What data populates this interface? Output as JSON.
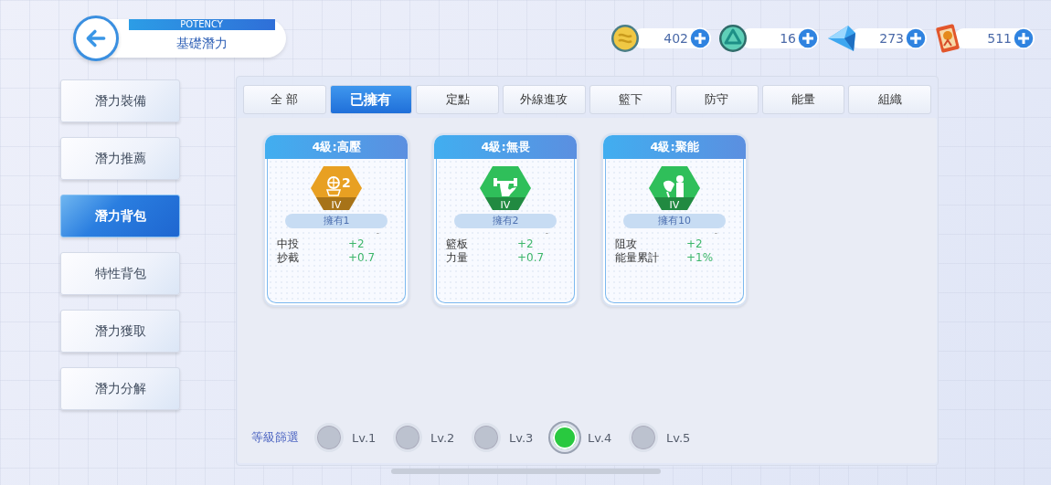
{
  "header": {
    "subtitle": "POTENCY",
    "title": "基礎潛力"
  },
  "currencies": [
    {
      "kind": "coin",
      "amount": "402"
    },
    {
      "kind": "swirl",
      "amount": "16"
    },
    {
      "kind": "gem",
      "amount": "273"
    },
    {
      "kind": "card",
      "amount": "511"
    }
  ],
  "sidebar": {
    "items": [
      {
        "label": "潛力裝備",
        "selected": false
      },
      {
        "label": "潛力推薦",
        "selected": false
      },
      {
        "label": "潛力背包",
        "selected": true
      },
      {
        "label": "特性背包",
        "selected": false
      },
      {
        "label": "潛力獲取",
        "selected": false
      },
      {
        "label": "潛力分解",
        "selected": false
      }
    ]
  },
  "tabs": [
    {
      "label": "全 部",
      "selected": false
    },
    {
      "label": "已擁有",
      "selected": true
    },
    {
      "label": "定點",
      "selected": false
    },
    {
      "label": "外線進攻",
      "selected": false
    },
    {
      "label": "籃下",
      "selected": false
    },
    {
      "label": "防守",
      "selected": false
    },
    {
      "label": "能量",
      "selected": false
    },
    {
      "label": "組織",
      "selected": false
    }
  ],
  "cards": [
    {
      "title": "4級:高壓",
      "kind": "shot",
      "color": "#e8a022",
      "badge_number": "2",
      "grade": "IV",
      "owned": "擁有1",
      "mark": "-",
      "stats": [
        {
          "name": "中投",
          "value": "+2"
        },
        {
          "name": "抄截",
          "value": "+0.7"
        }
      ]
    },
    {
      "title": "4級:無畏",
      "kind": "muscle",
      "color": "#2fbf5a",
      "grade": "IV",
      "owned": "擁有2",
      "mark": "-",
      "stats": [
        {
          "name": "籃板",
          "value": "+2"
        },
        {
          "name": "力量",
          "value": "+0.7"
        }
      ]
    },
    {
      "title": "4級:聚能",
      "kind": "block",
      "color": "#2fbf5a",
      "grade": "IV",
      "owned": "擁有10",
      "mark": "-",
      "stats": [
        {
          "name": "阻攻",
          "value": "+2"
        },
        {
          "name": "能量累計",
          "value": "+1%"
        }
      ]
    }
  ],
  "level_filter": {
    "label": "等級篩選",
    "options": [
      {
        "label": "Lv.1",
        "selected": false
      },
      {
        "label": "Lv.2",
        "selected": false
      },
      {
        "label": "Lv.3",
        "selected": false
      },
      {
        "label": "Lv.4",
        "selected": true
      },
      {
        "label": "Lv.5",
        "selected": false
      }
    ]
  }
}
